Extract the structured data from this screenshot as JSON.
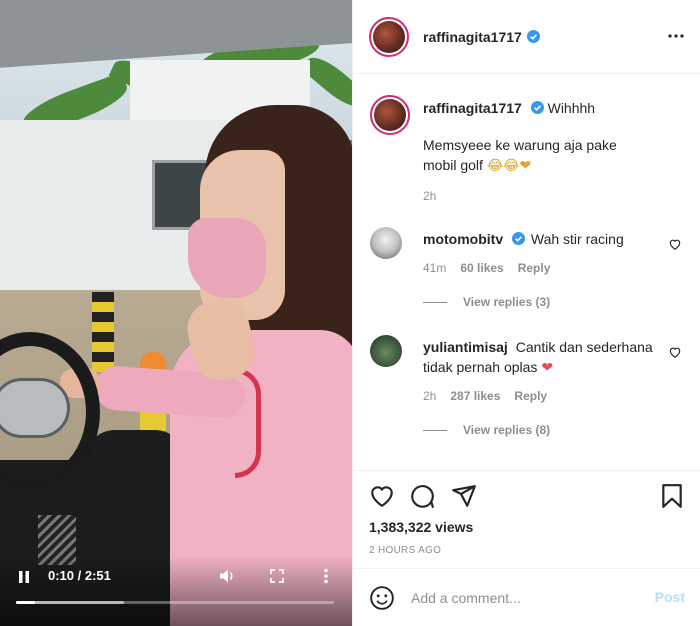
{
  "video": {
    "time_display": "0:10 / 2:51",
    "progress_fraction": 0.06,
    "buffered_fraction": 0.34,
    "play_state_icon": "pause-icon",
    "volume_icon": "volume-icon",
    "fullscreen_icon": "fullscreen-icon",
    "menu_icon": "more-vertical-icon"
  },
  "post": {
    "author": "raffinagita1717",
    "verified": true,
    "caption_author": "raffinagita1717",
    "caption_title": "Wihhhh",
    "caption_body": "Memsyeee ke warung aja pake mobil golf",
    "caption_emojis": "😂😂❤",
    "caption_time": "2h",
    "views": "1,383,322 views",
    "posted_ago": "2 HOURS AGO"
  },
  "comments": [
    {
      "user": "motomobitv",
      "verified": true,
      "text": "Wah stir racing",
      "time": "41m",
      "likes": "60 likes",
      "reply_label": "Reply",
      "view_replies": "View replies (3)"
    },
    {
      "user": "yuliantimisaj",
      "verified": false,
      "text": "Cantik dan sederhana tidak pernah oplas",
      "emoji": "❤",
      "time": "2h",
      "likes": "287 likes",
      "reply_label": "Reply",
      "view_replies": "View replies (8)"
    }
  ],
  "add_comment": {
    "placeholder": "Add a comment...",
    "post_label": "Post"
  },
  "colors": {
    "verified_blue": "#3897f0",
    "heart_red": "#ed4956",
    "post_disabled": "#b2dffc",
    "secondary_text": "#8e8e8e"
  }
}
